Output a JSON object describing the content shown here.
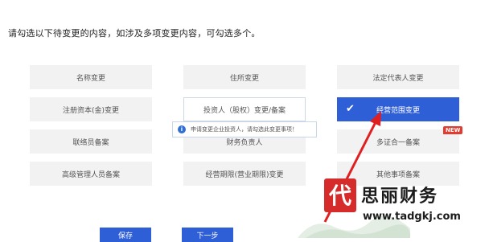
{
  "instruction": "请勾选以下待变更的内容，如涉及多项变更内容，可勾选多个。",
  "options": [
    {
      "label": "名称变更"
    },
    {
      "label": "住所变更"
    },
    {
      "label": "法定代表人变更"
    },
    {
      "label": "注册资本(金)变更"
    },
    {
      "label": "投资人（股权）变更/备案"
    },
    {
      "label": "经营范围变更",
      "selected": true
    },
    {
      "label": "联络员备案"
    },
    {
      "label": "财务负责人"
    },
    {
      "label": "多证合一备案",
      "badge": "NEW"
    },
    {
      "label": "高级管理人员备案"
    },
    {
      "label": "经营期限(营业期限)变更"
    },
    {
      "label": "其他事项备案"
    }
  ],
  "tooltip": {
    "icon": "info-icon",
    "text": "申请变更企业投资人，请勾选此变更事项！"
  },
  "buttons": {
    "save": "保存",
    "next": "下一步"
  },
  "watermark": {
    "brand": "思丽财务",
    "url": "www.tadgkj.com",
    "logo_char": "代"
  },
  "colors": {
    "primary": "#2f5fd6",
    "option_bg": "#f2f2f2",
    "badge": "#e23b2f",
    "arrow": "#e02020"
  }
}
